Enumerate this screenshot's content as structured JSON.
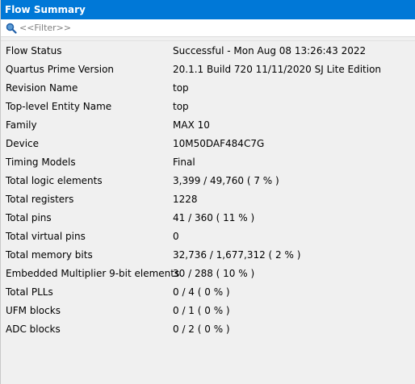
{
  "window": {
    "title": "Flow Summary"
  },
  "filter": {
    "placeholder": "<<Filter>>",
    "value": ""
  },
  "rows": [
    {
      "key": "Flow Status",
      "value": "Successful - Mon Aug 08 13:26:43 2022"
    },
    {
      "key": "Quartus Prime Version",
      "value": "20.1.1 Build 720 11/11/2020 SJ Lite Edition"
    },
    {
      "key": "Revision Name",
      "value": "top"
    },
    {
      "key": "Top-level Entity Name",
      "value": "top"
    },
    {
      "key": "Family",
      "value": "MAX 10"
    },
    {
      "key": "Device",
      "value": "10M50DAF484C7G"
    },
    {
      "key": "Timing Models",
      "value": "Final"
    },
    {
      "key": "Total logic elements",
      "value": "3,399 / 49,760 ( 7 % )"
    },
    {
      "key": "Total registers",
      "value": "1228"
    },
    {
      "key": "Total pins",
      "value": "41 / 360 ( 11 % )"
    },
    {
      "key": "Total virtual pins",
      "value": "0"
    },
    {
      "key": "Total memory bits",
      "value": "32,736 / 1,677,312 ( 2 % )"
    },
    {
      "key": "Embedded Multiplier 9-bit elements",
      "value": "30 / 288 ( 10 % )"
    },
    {
      "key": "Total PLLs",
      "value": "0 / 4 ( 0 % )"
    },
    {
      "key": "UFM blocks",
      "value": "0 / 1 ( 0 % )"
    },
    {
      "key": "ADC blocks",
      "value": "0 / 2 ( 0 % )"
    }
  ],
  "colors": {
    "title_bg": "#0078d7",
    "title_fg": "#ffffff",
    "panel_bg": "#f0f0f0"
  },
  "icons": {
    "filter": "search-icon"
  }
}
